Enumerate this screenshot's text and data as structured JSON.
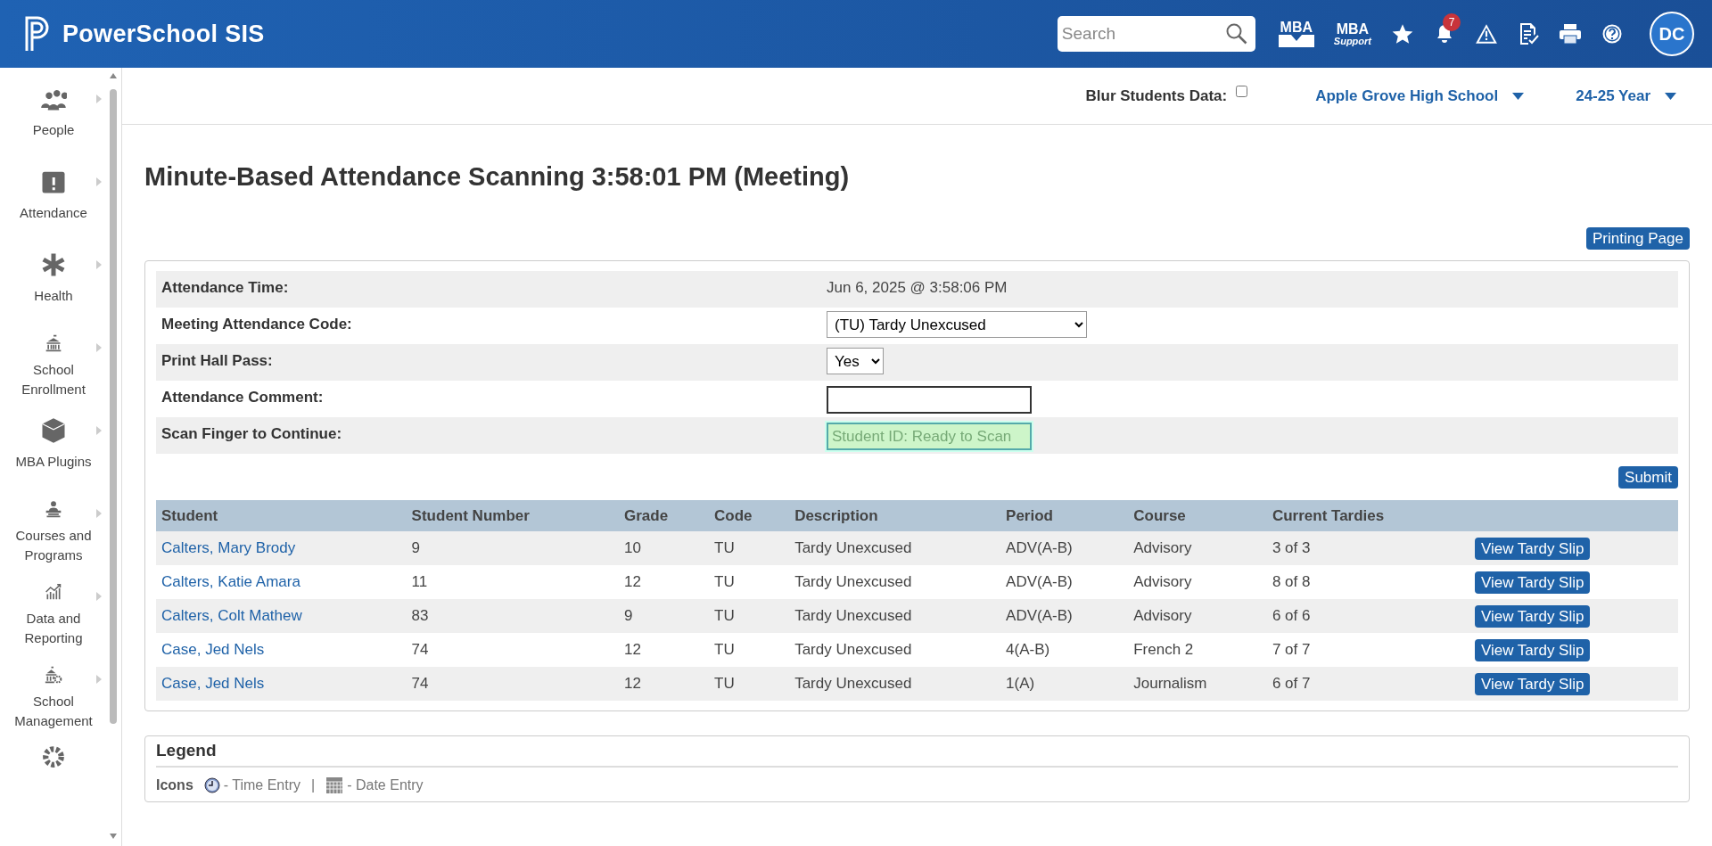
{
  "header": {
    "logo_text": "PowerSchool SIS",
    "search": {
      "placeholder": "Search"
    },
    "toolbar": [
      {
        "kind": "mba",
        "label": "MBA"
      },
      {
        "kind": "mba_support",
        "label": "MBA",
        "sublabel": "Support"
      },
      {
        "kind": "star"
      },
      {
        "kind": "bell",
        "badge": "7"
      },
      {
        "kind": "alert"
      },
      {
        "kind": "checklist"
      },
      {
        "kind": "print"
      },
      {
        "kind": "help"
      }
    ],
    "avatar": "DC"
  },
  "sidebar": {
    "items": [
      {
        "kind": "people",
        "label": "People"
      },
      {
        "kind": "attendance",
        "label": "Attendance"
      },
      {
        "kind": "health",
        "label": "Health"
      },
      {
        "kind": "enrollment",
        "label": "School Enrollment"
      },
      {
        "kind": "plugins",
        "label": "MBA Plugins"
      },
      {
        "kind": "courses",
        "label": "Courses and Programs"
      },
      {
        "kind": "data",
        "label": "Data and Reporting"
      },
      {
        "kind": "management",
        "label": "School Management"
      },
      {
        "kind": "settings"
      }
    ]
  },
  "subheader": {
    "blur_label": "Blur Students Data:",
    "blur_checked": false,
    "school": "Apple Grove High School",
    "year": "24-25 Year"
  },
  "page": {
    "title": "Minute-Based Attendance Scanning 3:58:01 PM (Meeting)",
    "print_button": "Printing Page",
    "form": [
      {
        "kind": "text",
        "label": "Attendance Time:",
        "value": "Jun 6, 2025 @ 3:58:06 PM"
      },
      {
        "kind": "select",
        "label": "Meeting Attendance Code:",
        "value": "(TU) Tardy Unexcused"
      },
      {
        "kind": "select_small",
        "label": "Print Hall Pass:",
        "value": "Yes"
      },
      {
        "kind": "input",
        "label": "Attendance Comment:"
      },
      {
        "kind": "scan",
        "label": "Scan Finger to Continue:",
        "placeholder": "Student ID: Ready to Scan"
      }
    ],
    "submit": "Submit",
    "table": {
      "columns": [
        "Student",
        "Student Number",
        "Grade",
        "Code",
        "Description",
        "Period",
        "Course",
        "Current Tardies"
      ],
      "rows": [
        {
          "student": "Calters, Mary Brody",
          "number": "9",
          "grade": "10",
          "code": "TU",
          "description": "Tardy Unexcused",
          "period": "ADV(A-B)",
          "course": "Advisory",
          "tardies": "3 of 3",
          "action": "View Tardy Slip"
        },
        {
          "student": "Calters, Katie Amara",
          "number": "11",
          "grade": "12",
          "code": "TU",
          "description": "Tardy Unexcused",
          "period": "ADV(A-B)",
          "course": "Advisory",
          "tardies": "8 of 8",
          "action": "View Tardy Slip"
        },
        {
          "student": "Calters, Colt Mathew",
          "number": "83",
          "grade": "9",
          "code": "TU",
          "description": "Tardy Unexcused",
          "period": "ADV(A-B)",
          "course": "Advisory",
          "tardies": "6 of 6",
          "action": "View Tardy Slip"
        },
        {
          "student": "Case, Jed Nels",
          "number": "74",
          "grade": "12",
          "code": "TU",
          "description": "Tardy Unexcused",
          "period": "4(A-B)",
          "course": "French 2",
          "tardies": "7 of 7",
          "action": "View Tardy Slip"
        },
        {
          "student": "Case, Jed Nels",
          "number": "74",
          "grade": "12",
          "code": "TU",
          "description": "Tardy Unexcused",
          "period": "1(A)",
          "course": "Journalism",
          "tardies": "6 of 7",
          "action": "View Tardy Slip"
        }
      ]
    }
  },
  "legend": {
    "title": "Legend",
    "icons_label": "Icons",
    "separator": "|",
    "entries": [
      {
        "kind": "clock",
        "label": "- Time Entry"
      },
      {
        "kind": "calendar",
        "label": "- Date Entry"
      }
    ]
  }
}
